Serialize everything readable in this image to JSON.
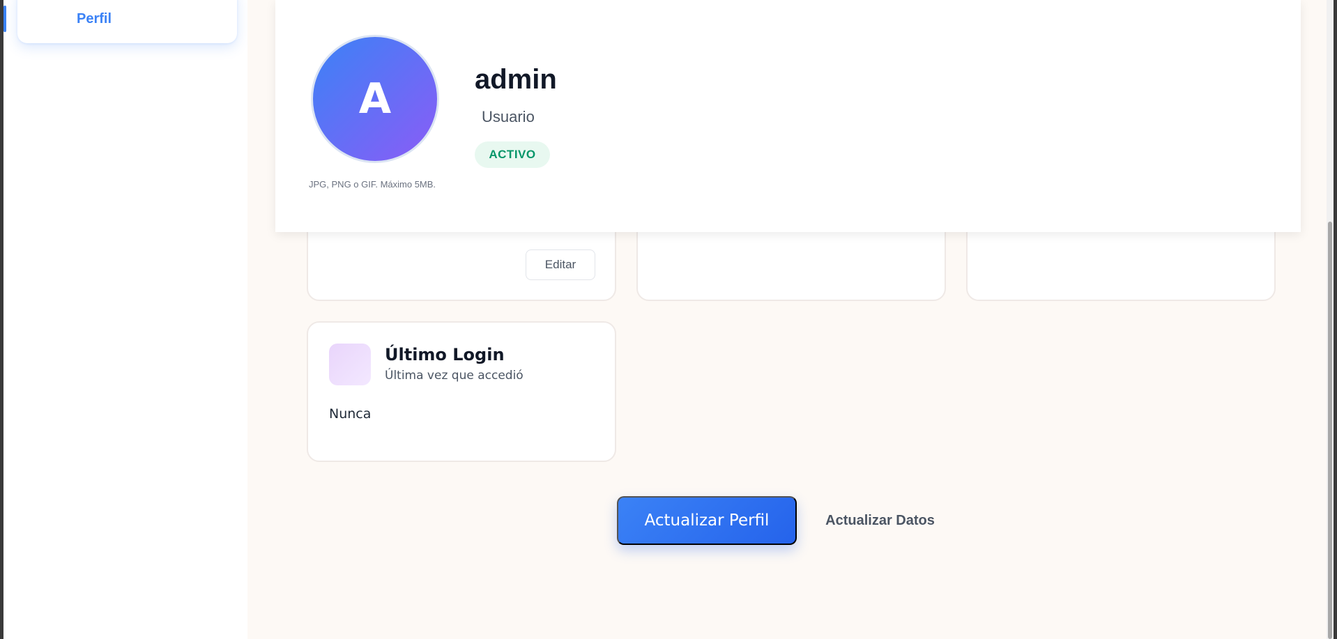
{
  "sidebar": {
    "items": [
      {
        "label": "Perfil"
      }
    ]
  },
  "profile": {
    "avatar_letter": "A",
    "avatar_note": "JPG, PNG o GIF. Máximo 5MB.",
    "name": "admin",
    "role": "Usuario",
    "status": "ACTIVO"
  },
  "cards": {
    "edit_label": "Editar",
    "last_login": {
      "title": "Último Login",
      "subtitle": "Última vez que accedió",
      "value": "Nunca"
    }
  },
  "actions": {
    "primary_label": "Actualizar Perfil",
    "secondary_label": "Actualizar Datos"
  },
  "colors": {
    "accent": "#3b82f6",
    "status_green": "#059669",
    "background": "#fdf9f5"
  }
}
